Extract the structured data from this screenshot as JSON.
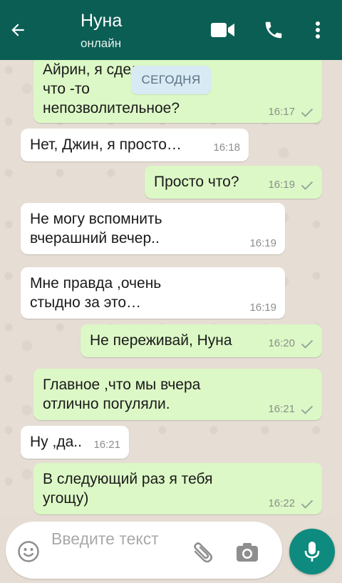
{
  "header": {
    "contact_name": "Нуна",
    "status": "онлайн",
    "back_icon": "arrow-left-icon",
    "video_icon": "video-camera-icon",
    "call_icon": "phone-icon",
    "menu_icon": "vertical-dots-icon"
  },
  "colors": {
    "header": "#0b5e54",
    "outgoing_bubble": "#dcf8c6",
    "incoming_bubble": "#ffffff",
    "mic_button": "#0e8b7e",
    "chat_background": "#e6ded4"
  },
  "date_chip": "СЕГОДНЯ",
  "messages": [
    {
      "direction": "outgoing",
      "text": "Айрин, я сделала\nчто -то\nнепозволительное?",
      "time": "16:17",
      "status": "sent"
    },
    {
      "direction": "incoming",
      "text": "Нет, Джин, я просто…",
      "time": "16:18"
    },
    {
      "direction": "outgoing",
      "text": "Просто что?",
      "time": "16:19",
      "status": "sent"
    },
    {
      "direction": "incoming",
      "text": "Не могу вспомнить\nвчерашний вечер..",
      "time": "16:19"
    },
    {
      "direction": "incoming",
      "text": "Мне правда ,очень\nстыдно за это…",
      "time": "16:19"
    },
    {
      "direction": "outgoing",
      "text": "Не переживай, Нуна",
      "time": "16:20",
      "status": "sent"
    },
    {
      "direction": "outgoing",
      "text": "Главное ,что мы вчера\nотлично погуляли.",
      "time": "16:21",
      "status": "sent"
    },
    {
      "direction": "incoming",
      "text": "Ну ,да..",
      "time": "16:21"
    },
    {
      "direction": "outgoing",
      "text": "В следующий раз я тебя\nугощу)",
      "time": "16:22",
      "status": "sent"
    }
  ],
  "composer": {
    "placeholder": "Введите текст",
    "value": "",
    "emoji_icon": "smiley-icon",
    "attach_icon": "paperclip-icon",
    "camera_icon": "camera-icon",
    "mic_icon": "microphone-icon"
  }
}
